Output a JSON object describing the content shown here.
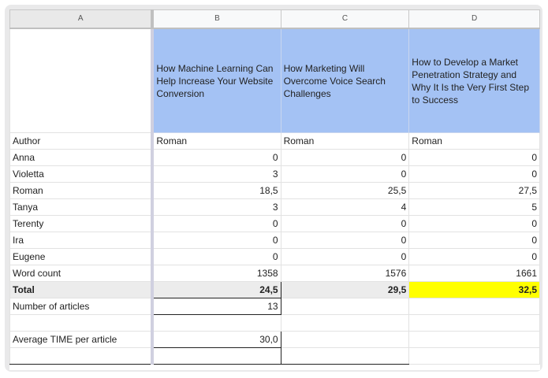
{
  "columns": [
    "A",
    "B",
    "C",
    "D"
  ],
  "titles": {
    "b": "How Machine Learning Can Help Increase Your Website Conversion",
    "c": "How Marketing Will Overcome Voice Search Challenges",
    "d": "How to Develop a Market Penetration Strategy and Why It Is the Very First Step to Success"
  },
  "rows": {
    "author": {
      "label": "Author",
      "b": "Roman",
      "c": "Roman",
      "d": "Roman"
    },
    "anna": {
      "label": "Anna",
      "b": "0",
      "c": "0",
      "d": "0"
    },
    "violetta": {
      "label": "Violetta",
      "b": "3",
      "c": "0",
      "d": "0"
    },
    "roman": {
      "label": "Roman",
      "b": "18,5",
      "c": "25,5",
      "d": "27,5"
    },
    "tanya": {
      "label": "Tanya",
      "b": "3",
      "c": "4",
      "d": "5"
    },
    "terenty": {
      "label": "Terenty",
      "b": "0",
      "c": "0",
      "d": "0"
    },
    "ira": {
      "label": "Ira",
      "b": "0",
      "c": "0",
      "d": "0"
    },
    "eugene": {
      "label": "Eugene",
      "b": "0",
      "c": "0",
      "d": "0"
    },
    "words": {
      "label": "Word count",
      "b": "1358",
      "c": "1576",
      "d": "1661"
    },
    "total": {
      "label": "Total",
      "b": "24,5",
      "c": "29,5",
      "d": "32,5"
    }
  },
  "summary": {
    "articles_label": "Number of articles",
    "articles_value": "13",
    "avg_label": "Average TIME per article",
    "avg_value": "30,0"
  },
  "colors": {
    "title_fill": "#a4c2f4",
    "highlight": "#ffff00",
    "total_fill": "#ececec"
  }
}
